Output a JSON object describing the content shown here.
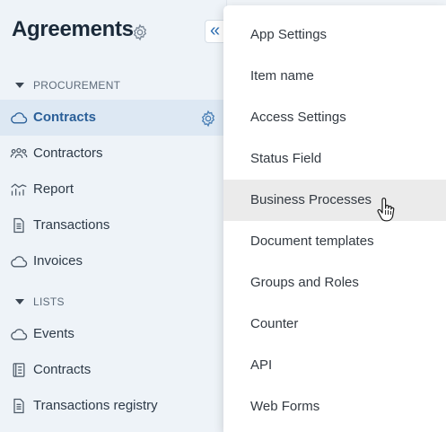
{
  "sidebar": {
    "title": "Agreements",
    "sections": [
      {
        "label": "PROCUREMENT"
      },
      {
        "label": "LISTS"
      }
    ],
    "procurement_items": [
      {
        "label": "Contracts"
      },
      {
        "label": "Contractors"
      },
      {
        "label": "Report"
      },
      {
        "label": "Transactions"
      },
      {
        "label": "Invoices"
      }
    ],
    "list_items": [
      {
        "label": "Events"
      },
      {
        "label": "Contracts"
      },
      {
        "label": "Transactions registry"
      }
    ],
    "collapse_glyph": "«"
  },
  "menu": {
    "items": [
      {
        "label": "App Settings"
      },
      {
        "label": "Item name"
      },
      {
        "label": "Access Settings"
      },
      {
        "label": "Status Field"
      },
      {
        "label": "Business Processes"
      },
      {
        "label": "Document templates"
      },
      {
        "label": "Groups and Roles"
      },
      {
        "label": "Counter"
      },
      {
        "label": "API"
      },
      {
        "label": "Web Forms"
      }
    ],
    "hovered": "Business Processes"
  },
  "colors": {
    "accent": "#2a5f98",
    "active_bg": "#dde8f3",
    "hover_bg": "#ebebeb"
  }
}
